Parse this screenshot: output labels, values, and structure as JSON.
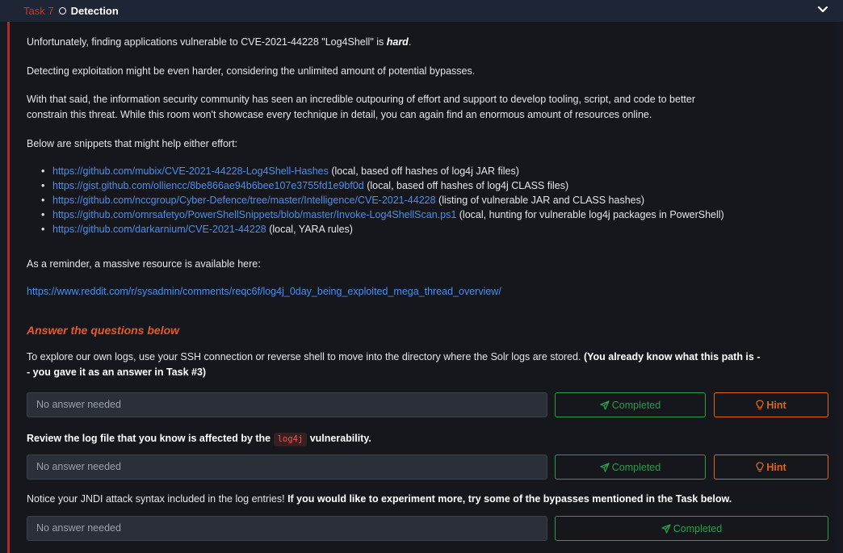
{
  "header": {
    "task_label": "Task 7",
    "title": "Detection"
  },
  "intro": {
    "p1_prefix": "Unfortunately, finding applications vulnerable to CVE-2021-44228 \"Log4Shell\" is ",
    "p1_emphasis": "hard",
    "p1_suffix": ".",
    "p2": "Detecting exploitation might be even harder, considering the unlimited amount of potential bypasses.",
    "p3_line1": "With that said, the information security community has seen an incredible outpouring of effort and support to develop tooling, script, and code to better",
    "p3_line2": "constrain this threat. While this room won't showcase every technique in detail, you can again find an enormous amount of resources online.",
    "p4": "Below are snippets that might help either effort:"
  },
  "links": [
    {
      "url": "https://github.com/mubix/CVE-2021-44228-Log4Shell-Hashes",
      "note": " (local, based off hashes of log4j JAR files)"
    },
    {
      "url": "https://gist.github.com/olliencc/8be866ae94b6bee107e3755fd1e9bf0d",
      "note": " (local, based off hashes of log4j CLASS files)"
    },
    {
      "url": "https://github.com/nccgroup/Cyber-Defence/tree/master/Intelligence/CVE-2021-44228",
      "note": " (listing of vulnerable JAR and CLASS hashes)"
    },
    {
      "url": "https://github.com/omrsafetyo/PowerShellSnippets/blob/master/Invoke-Log4ShellScan.ps1",
      "note": " (local, hunting for vulnerable log4j packages in PowerShell)"
    },
    {
      "url": "https://github.com/darkarnium/CVE-2021-44228",
      "note": " (local, YARA rules)"
    }
  ],
  "reminder": {
    "text": "As a reminder, a massive resource is available here:",
    "url": "https://www.reddit.com/r/sysadmin/comments/reqc6f/log4j_0day_being_exploited_mega_thread_overview/"
  },
  "answers_heading": "Answer the questions below",
  "questions": [
    {
      "text_line1_plain": "To explore our own logs, use your SSH connection or reverse shell to move into the directory where the Solr logs are stored. ",
      "text_line1_bold": "(You already know what this path is -",
      "text_line2_bold": "- you gave it as an answer in Task #3)",
      "placeholder": "No answer needed",
      "completed_label": "Completed",
      "hint_label": "Hint"
    },
    {
      "text_prefix": "Review the log file that you know is affected by the ",
      "code": "log4j",
      "text_suffix": " vulnerability.",
      "placeholder": "No answer needed",
      "completed_label": "Completed",
      "hint_label": "Hint"
    },
    {
      "text_plain": "Notice your JNDI attack syntax included in the log entries! ",
      "text_bold": "If you would like to experiment more, try some of the bypasses mentioned in the Task below.",
      "placeholder": "No answer needed",
      "completed_label": "Completed"
    }
  ],
  "colors": {
    "accent_red": "#b3282d",
    "success_green": "#2a9d4a",
    "hint_orange": "#e2661a",
    "link_blue": "#4a8ff0"
  },
  "icons": [
    "circle-icon",
    "chevron-down-icon",
    "paper-plane-icon",
    "lightbulb-icon"
  ]
}
